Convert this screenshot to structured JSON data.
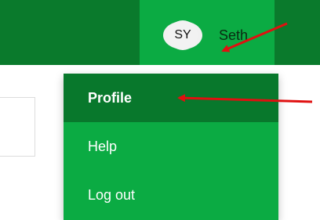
{
  "header": {
    "avatar_initials": "SY",
    "username": "Seth"
  },
  "menu": {
    "items": [
      {
        "label": "Profile"
      },
      {
        "label": "Help"
      },
      {
        "label": "Log out"
      }
    ]
  },
  "colors": {
    "header_dark": "#0a7a2c",
    "header_accent": "#0bab43",
    "menu_active": "#08782c",
    "annotation_arrow": "#e01010"
  }
}
